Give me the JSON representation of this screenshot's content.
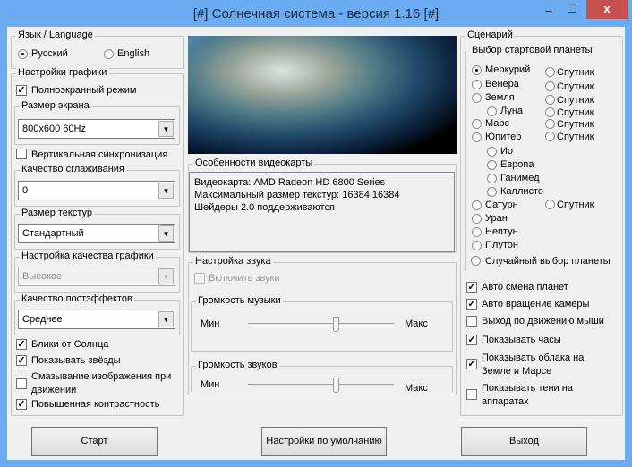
{
  "window": {
    "title": "[#] Солнечная система - версия 1.16 [#]",
    "minimize": "–",
    "maximize": "☐",
    "close": "x"
  },
  "language": {
    "legend": "Язык / Language",
    "options": [
      {
        "label": "Русский",
        "selected": true
      },
      {
        "label": "English",
        "selected": false
      }
    ]
  },
  "graphics": {
    "legend": "Настройки графики",
    "fullscreen": {
      "label": "Полноэкранный режим",
      "checked": true
    },
    "screen_size": {
      "legend": "Размер экрана",
      "value": "800x600 60Hz"
    },
    "vsync": {
      "label": "Вертикальная синхронизация",
      "checked": false
    },
    "antialias": {
      "legend": "Качество сглаживания",
      "value": "0"
    },
    "texture_size": {
      "legend": "Размер текстур",
      "value": "Стандартный"
    },
    "quality": {
      "legend": "Настройка качества графики",
      "value": "Высокое"
    },
    "post": {
      "legend": "Качество постэффектов",
      "value": "Среднее"
    },
    "checks": [
      {
        "label": "Блики от Солнца",
        "checked": true
      },
      {
        "label": "Показывать звёзды",
        "checked": true
      },
      {
        "label": "Смазывание изображения при движении",
        "checked": false
      },
      {
        "label": "Повышенная контрастность",
        "checked": true
      }
    ]
  },
  "video": {
    "legend": "Особенности видеокарты",
    "lines": [
      "Видеокарта: AMD Radeon HD 6800 Series",
      "Максимальный размер текстур: 16384 16384",
      "Шейдеры 2.0 поддерживаются"
    ]
  },
  "sound": {
    "legend": "Настройка звука",
    "enable": {
      "label": "Включить звуки",
      "checked": false
    },
    "music": {
      "legend": "Громкость музыки",
      "min": "Мин",
      "max": "Макс",
      "value": 0.6
    },
    "effects": {
      "legend": "Громкость звуков",
      "min": "Мин",
      "max": "Макс",
      "value": 0.6
    }
  },
  "scenario": {
    "legend": "Сценарий",
    "start_legend": "Выбор стартовой планеты",
    "planets": [
      {
        "label": "Меркурий",
        "selected": true
      },
      {
        "label": "Венера"
      },
      {
        "label": "Земля"
      },
      {
        "label": "Луна",
        "sub": true
      },
      {
        "label": "Марс"
      },
      {
        "label": "Юпитер"
      },
      {
        "label": "Ио",
        "sub": true
      },
      {
        "label": "Европа",
        "sub": true
      },
      {
        "label": "Ганимед",
        "sub": true
      },
      {
        "label": "Каллисто",
        "sub": true
      },
      {
        "label": "Сатурн"
      },
      {
        "label": "Уран"
      },
      {
        "label": "Нептун"
      },
      {
        "label": "Плутон"
      }
    ],
    "satellites": [
      "Спутник",
      "Спутник",
      "Спутник",
      "Спутник",
      "Спутник",
      "Спутник",
      "Спутник"
    ],
    "random": "Случайный выбор планеты",
    "options": [
      {
        "label": "Авто смена планет",
        "checked": true
      },
      {
        "label": "Авто вращение камеры",
        "checked": true
      },
      {
        "label": "Выход по движению мыши",
        "checked": false
      },
      {
        "label": "Показывать часы",
        "checked": true
      },
      {
        "label": "Показывать облака на Земле и Марсе",
        "checked": true
      },
      {
        "label": "Показывать тени на аппаратах",
        "checked": false
      }
    ]
  },
  "buttons": {
    "start": "Старт",
    "defaults": "Настройки по умолчанию",
    "exit": "Выход"
  }
}
